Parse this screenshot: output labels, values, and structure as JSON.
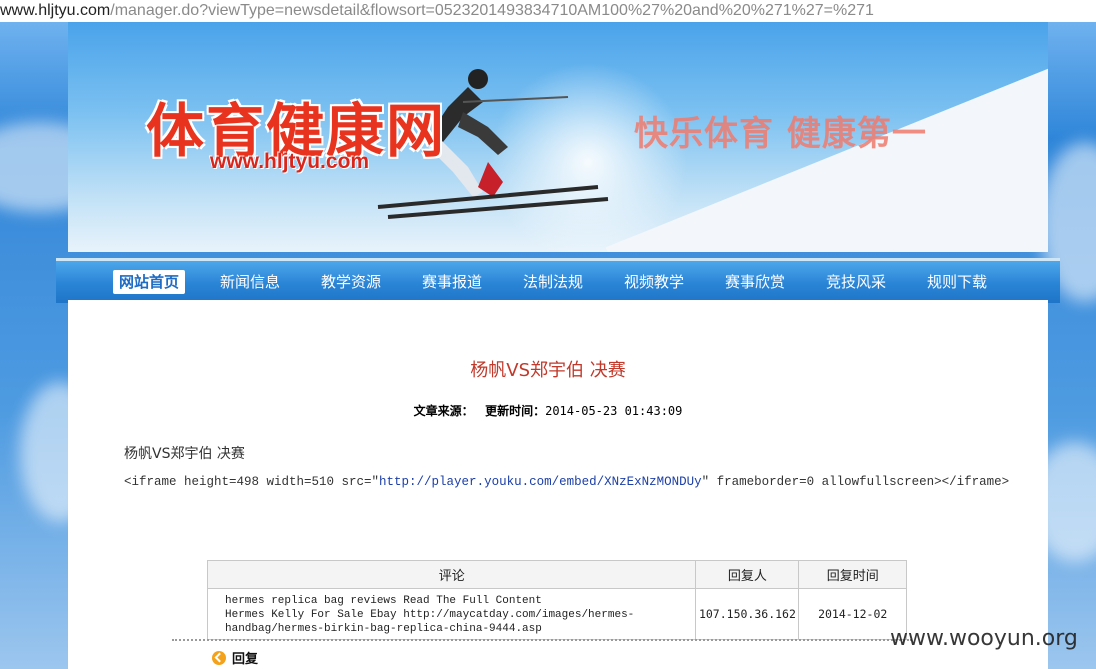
{
  "address_bar": {
    "host": "www.hljtyu.com",
    "path": "/manager.do?viewType=newsdetail&flowsort=0523201493834710AM100%27%20and%20%271%27=%271"
  },
  "banner": {
    "title": "体育健康网",
    "url": "www.hljtyu.com",
    "slogan": "快乐体育  健康第一"
  },
  "nav": {
    "items": [
      "网站首页",
      "新闻信息",
      "教学资源",
      "赛事报道",
      "法制法规",
      "视频教学",
      "赛事欣赏",
      "竞技风采",
      "规则下载"
    ],
    "active_index": 0
  },
  "article": {
    "title": "杨帆VS郑宇伯 决赛",
    "source_label": "文章来源：",
    "updated_label": "更新时间：",
    "updated_value": "2014-05-23 01:43:09",
    "body_title": "杨帆VS郑宇伯 决赛",
    "code_prefix": "<iframe height=498 width=510 src=\"",
    "code_link": "http://player.youku.com/embed/XNzExNzMONDUy",
    "code_suffix": "\" frameborder=0 allowfullscreen></iframe>"
  },
  "comments": {
    "headers": [
      "评论",
      "回复人",
      "回复时间"
    ],
    "rows": [
      {
        "lines": [
          "hermes replica bag reviews Read The Full Content",
          "Hermes Kelly For Sale Ebay http://maycatday.com/images/hermes-",
          "handbag/hermes-birkin-bag-replica-china-9444.asp"
        ],
        "replier": "107.150.36.162",
        "time": "2014-12-02"
      }
    ]
  },
  "reply": {
    "label": "回复"
  },
  "watermark": "www.wooyun.org",
  "colors": {
    "nav_blue": "#2a84d6",
    "title_red": "#c0392b",
    "logo_red": "#e8331f",
    "link_blue": "#1c3fa8"
  }
}
